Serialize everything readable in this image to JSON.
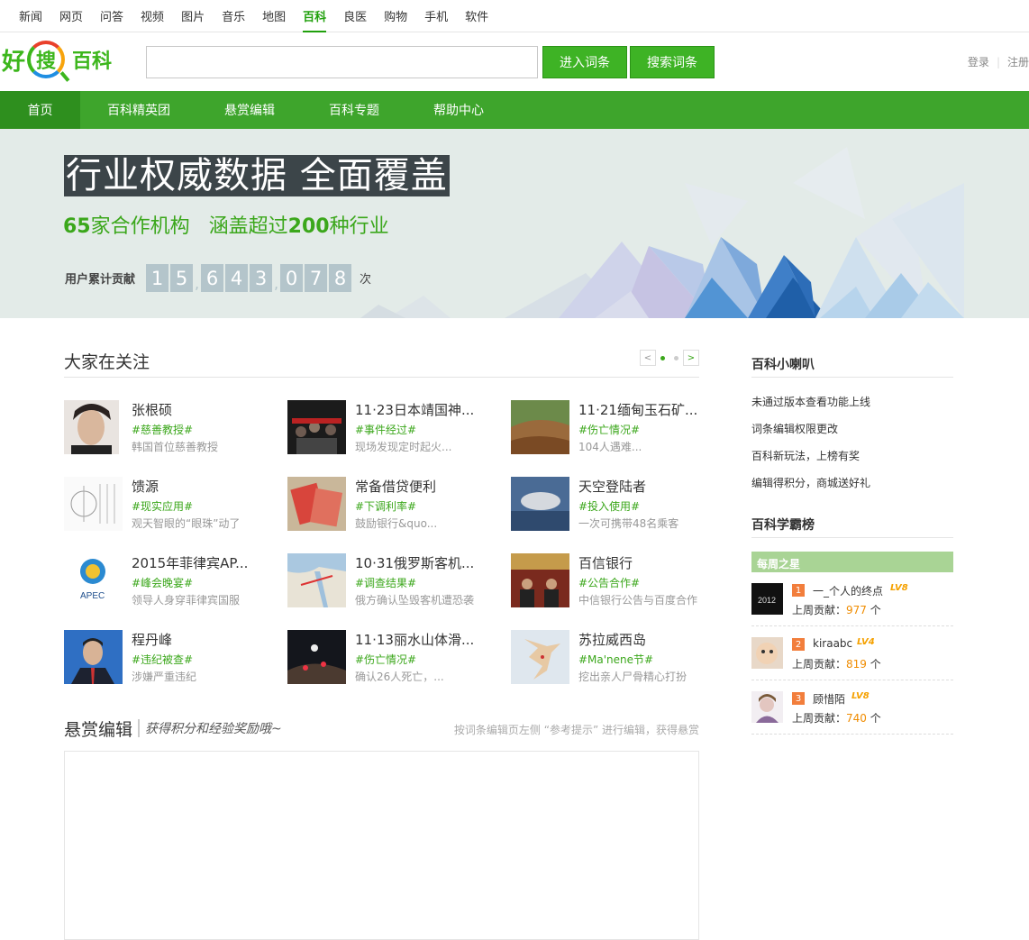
{
  "topnav": [
    "新闻",
    "网页",
    "问答",
    "视频",
    "图片",
    "音乐",
    "地图",
    "百科",
    "良医",
    "购物",
    "手机",
    "软件"
  ],
  "topnav_active": "百科",
  "logo": {
    "hao": "好",
    "sou": "搜",
    "baike": "百科"
  },
  "search": {
    "value": "",
    "placeholder": ""
  },
  "buttons": {
    "enter": "进入词条",
    "search": "搜索词条"
  },
  "user": {
    "login": "登录",
    "register": "注册"
  },
  "mainnav": [
    "首页",
    "百科精英团",
    "悬赏编辑",
    "百科专题",
    "帮助中心"
  ],
  "banner": {
    "title": "行业权威数据 全面覆盖",
    "sub_num1": "65",
    "sub_text1": "家合作机构",
    "sub_text2": "涵盖超过",
    "sub_num2": "200",
    "sub_text3": "种行业",
    "count_label": "用户累计贡献",
    "digits": [
      "1",
      "5",
      ",",
      "6",
      "4",
      "3",
      ",",
      "0",
      "7",
      "8"
    ],
    "count_unit": "次"
  },
  "attention": {
    "title": "大家在关注",
    "prev": "<",
    "next": ">",
    "items": [
      {
        "title": "张根硕",
        "tag": "#慈善教授#",
        "desc": "韩国首位慈善教授"
      },
      {
        "title": "11·23日本靖国神...",
        "tag": "#事件经过#",
        "desc": "现场发现定时起火..."
      },
      {
        "title": "11·21缅甸玉石矿...",
        "tag": "#伤亡情况#",
        "desc": "104人遇难..."
      },
      {
        "title": "馈源",
        "tag": "#现实应用#",
        "desc": "观天智眼的“眼珠”动了"
      },
      {
        "title": "常备借贷便利",
        "tag": "#下调利率#",
        "desc": "鼓励银行&quo..."
      },
      {
        "title": "天空登陆者",
        "tag": "#投入使用#",
        "desc": "一次可携带48名乘客"
      },
      {
        "title": "2015年菲律宾AP...",
        "tag": "#峰会晚宴#",
        "desc": "领导人身穿菲律宾国服"
      },
      {
        "title": "10·31俄罗斯客机...",
        "tag": "#调查结果#",
        "desc": "俄方确认坠毁客机遭恐袭"
      },
      {
        "title": "百信银行",
        "tag": "#公告合作#",
        "desc": "中信银行公告与百度合作"
      },
      {
        "title": "程丹峰",
        "tag": "#违纪被查#",
        "desc": "涉嫌严重违纪"
      },
      {
        "title": "11·13丽水山体滑...",
        "tag": "#伤亡情况#",
        "desc": "确认26人死亡，..."
      },
      {
        "title": "苏拉威西岛",
        "tag": "#Ma'nene节#",
        "desc": "挖出亲人尸骨精心打扮"
      }
    ]
  },
  "reward": {
    "title": "悬赏编辑",
    "handwriting": "获得积分和经验奖励哦~",
    "tip": "按词条编辑页左侧 “参考提示” 进行编辑，获得悬赏"
  },
  "sidebar": {
    "horn_title": "百科小喇叭",
    "horn_items": [
      "未通过版本查看功能上线",
      "词条编辑权限更改",
      "百科新玩法，上榜有奖",
      "编辑得积分，商城送好礼"
    ],
    "rank_title": "百科学霸榜",
    "weekly": "每周之星",
    "stars": [
      {
        "rank": "1",
        "name": "一_个人的终点",
        "level": "LV8",
        "contrib_label": "上周贡献：",
        "contrib": "977",
        "unit": "个"
      },
      {
        "rank": "2",
        "name": "kiraabc",
        "level": "LV4",
        "contrib_label": "上周贡献：",
        "contrib": "819",
        "unit": "个"
      },
      {
        "rank": "3",
        "name": "顾惜陌",
        "level": "LV8",
        "contrib_label": "上周贡献：",
        "contrib": "740",
        "unit": "个"
      }
    ]
  },
  "colors": {
    "accent": "#3ea52c",
    "accent_dark": "#2e8f1e",
    "tag": "#3ba71b",
    "contrib": "#f08c00"
  }
}
